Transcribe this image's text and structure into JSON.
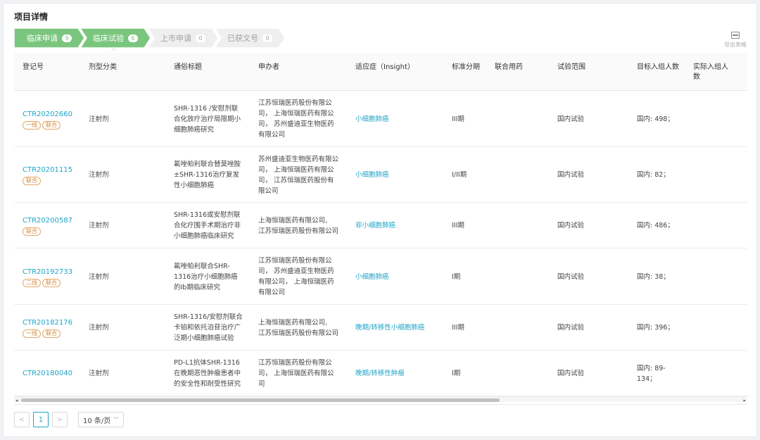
{
  "page": {
    "title": "项目详情"
  },
  "tabs": [
    {
      "label": "临床申请",
      "count": "9",
      "active": true
    },
    {
      "label": "临床试验",
      "count": "6",
      "active": true
    },
    {
      "label": "上市申请",
      "count": "0",
      "active": false
    },
    {
      "label": "已获文号",
      "count": "0",
      "active": false
    }
  ],
  "export": {
    "label": "导出表格",
    "icon": "export-table-icon"
  },
  "table": {
    "headers": [
      "登记号",
      "剂型分类",
      "通俗标题",
      "申办者",
      "适应症（Insight）",
      "标准分期",
      "联合用药",
      "试验范围",
      "目标入组人数",
      "实际入组人数"
    ],
    "rows": [
      {
        "id": "CTR20202660",
        "tags": [
          "一线",
          "联合"
        ],
        "form": "注射剂",
        "title": [
          "SHR-1316 /安慰剂联",
          "合化放疗治疗局限期小",
          "细胞肺癌研究"
        ],
        "sponsor": [
          "江苏恒瑞医药股份有限公",
          "司， 上海恒瑞医药有限公",
          "司， 苏州盛迪亚生物医药",
          "有限公司"
        ],
        "indication": "小细胞肺癌",
        "phase": "III期",
        "combo": "",
        "scope": "国内试验",
        "target": [
          "国内: 498；"
        ],
        "actual": ""
      },
      {
        "id": "CTR20201115",
        "tags": [
          "联合"
        ],
        "form": "注射剂",
        "title": [
          "氟唑帕利联合替莫唑胺",
          "±SHR-1316治疗复发",
          "性小细胞肺癌"
        ],
        "sponsor": [
          "苏州盛迪亚生物医药有限公",
          "司， 上海恒瑞医药有限公",
          "司， 江苏恒瑞医药股份有",
          "限公司"
        ],
        "indication": "小细胞肺癌",
        "phase": "I/II期",
        "combo": "",
        "scope": "国内试验",
        "target": [
          "国内: 82；"
        ],
        "actual": ""
      },
      {
        "id": "CTR20200587",
        "tags": [
          "联合"
        ],
        "form": "注射剂",
        "title": [
          "SHR-1316或安慰剂联",
          "合化疗围手术期治疗非",
          "小细胞肺癌临床研究"
        ],
        "sponsor": [
          "上海恒瑞医药有限公司,",
          "江苏恒瑞医药股份有限公司"
        ],
        "indication": "非小细胞肺癌",
        "phase": "III期",
        "combo": "",
        "scope": "国内试验",
        "target": [
          "国内: 486；"
        ],
        "actual": ""
      },
      {
        "id": "CTR20192733",
        "tags": [
          "二线",
          "联合"
        ],
        "form": "注射剂",
        "title": [
          "氟唑帕利联合SHR-",
          "1316治疗小细胞肺癌",
          "的Ib期临床研究"
        ],
        "sponsor": [
          "江苏恒瑞医药股份有限公",
          "司， 苏州盛迪亚生物医药",
          "有限公司， 上海恒瑞医药",
          "有限公司"
        ],
        "indication": "小细胞肺癌",
        "phase": "I期",
        "combo": "",
        "scope": "国内试验",
        "target": [
          "国内: 38；"
        ],
        "actual": ""
      },
      {
        "id": "CTR20182176",
        "tags": [
          "一线",
          "联合"
        ],
        "form": "注射剂",
        "title": [
          "SHR-1316/安慰剂联合",
          "卡铂和依托泊苷治疗广",
          "泛期小细胞肺癌试验"
        ],
        "sponsor": [
          "上海恒瑞医药有限公司,",
          "江苏恒瑞医药股份有限公司"
        ],
        "indication": "晚期/转移性小细胞肺癌",
        "phase": "III期",
        "combo": "",
        "scope": "国内试验",
        "target": [
          "国内: 396；"
        ],
        "actual": ""
      },
      {
        "id": "CTR20180040",
        "tags": [],
        "form": "注射剂",
        "title": [
          "PD-L1抗体SHR-1316",
          "在晚期恶性肿瘤患者中",
          "的安全性和耐受性研究"
        ],
        "sponsor": [
          "江苏恒瑞医药股份有限公",
          "司， 上海恒瑞医药有限公",
          "司"
        ],
        "indication": "晚期/转移性肿瘤",
        "phase": "I期",
        "combo": "",
        "scope": "国内试验",
        "target": [
          "国内: 89-",
          "134；"
        ],
        "actual": ""
      }
    ]
  },
  "pagination": {
    "prev": "<",
    "current": "1",
    "next": ">",
    "page_size": "10 条/页"
  },
  "colors": {
    "accent": "#1fa4c7",
    "tab_active": "#7bc67e",
    "tab_inactive": "#efefef",
    "tag": "#d48a3a"
  }
}
